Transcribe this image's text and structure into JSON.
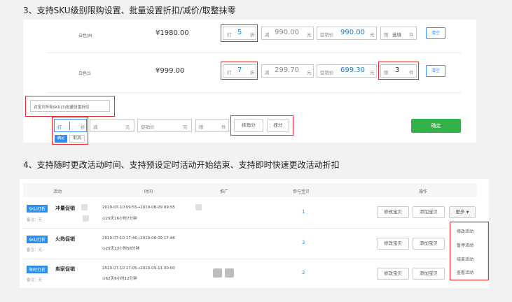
{
  "section3": {
    "heading": "3、支持SKU级别限购设置、批量设置折扣/减价/取整抹零"
  },
  "sku_rows": [
    {
      "name": "白色|M",
      "price": "¥1980.00",
      "discount_label": "打",
      "discount_value": "5",
      "discount_unit": "折",
      "minus_label": "减",
      "minus_value": "990.00",
      "minus_unit": "元",
      "promo_label": "促销价",
      "promo_value": "990.00",
      "promo_unit": "元",
      "limit_label": "限",
      "limit_value": "选填",
      "limit_unit": "件",
      "clear_label": "清空"
    },
    {
      "name": "白色|S",
      "price": "¥999.00",
      "discount_label": "打",
      "discount_value": "7",
      "discount_unit": "折",
      "minus_label": "减",
      "minus_value": "299.70",
      "minus_unit": "元",
      "promo_label": "促销价",
      "promo_value": "699.30",
      "promo_unit": "元",
      "limit_label": "限",
      "limit_value": "3",
      "limit_unit": "件",
      "clear_label": "清空"
    }
  ],
  "batch": {
    "hint": "对宝贝所有SKU(3)批量设置折扣",
    "discount_label": "打",
    "discount_unit": "折",
    "minus_label": "减",
    "minus_unit": "元",
    "promo_label": "促销价",
    "promo_unit": "元",
    "limit_label": "限",
    "limit_unit": "件",
    "confirm_small": "确定",
    "cancel_small": "取消",
    "round_jiao": "抹角分",
    "round_fen": "抹分",
    "confirm": "确定"
  },
  "section4": {
    "heading": "4、支持随时更改活动时间、支持预设定时活动开始结束、支持即时快速更改活动折扣"
  },
  "table": {
    "headers": [
      "活动",
      "时间",
      "推广",
      "参与宝贝",
      "操作"
    ],
    "rows": [
      {
        "tag": "SKU打折",
        "name": "冲量促销",
        "note": "备注：无",
        "time": "2019-07-10 09:55→2019-08-09 09:55",
        "remain": "⊙29天16小时7分钟",
        "count": "1",
        "edit_btn": "修改宝贝",
        "add_btn": "添加宝贝",
        "more_btn": "更多"
      },
      {
        "tag": "SKU打折",
        "name": "火热促销",
        "note": "备注：无",
        "time": "2019-07-10 17:46→2019-08-09 17:46",
        "remain": "⊙29天23小时58分钟",
        "count": "3",
        "edit_btn": "修改宝贝",
        "add_btn": "添加宝贝"
      },
      {
        "tag": "限时打折",
        "name": "卖家促销",
        "note": "备注：无",
        "time": "2019-07-10 17:05→2019-09-11 00:00",
        "remain": "⊙62天6小时12分钟",
        "count": "2",
        "edit_btn": "修改宝贝",
        "add_btn": "添加宝贝"
      }
    ],
    "menu": [
      "修改活动",
      "暂停活动",
      "结束活动",
      "查看活动"
    ]
  },
  "colors": {
    "accent": "#2d8cf0",
    "highlight_red": "#e23030",
    "confirm_green": "#33b24a"
  }
}
